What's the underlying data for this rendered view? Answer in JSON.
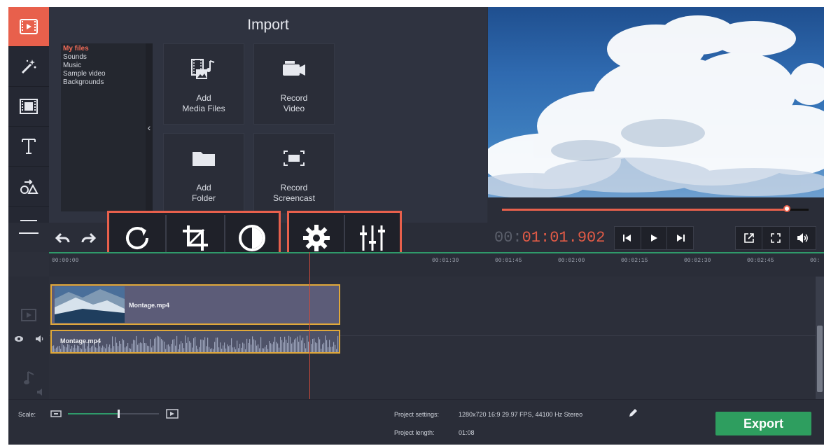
{
  "sidebar": {
    "items": [
      {
        "name": "import-tab",
        "icon": "film-import-icon",
        "active": true
      },
      {
        "name": "magic-tab",
        "icon": "magic-wand-icon",
        "active": false
      },
      {
        "name": "filters-tab",
        "icon": "film-strip-icon",
        "active": false
      },
      {
        "name": "titles-tab",
        "icon": "text-icon",
        "active": false
      },
      {
        "name": "transitions-tab",
        "icon": "shapes-icon",
        "active": false
      },
      {
        "name": "more-tab",
        "icon": "list-icon",
        "active": false
      }
    ]
  },
  "import": {
    "title": "Import",
    "files": [
      "My files",
      "Sounds",
      "Music",
      "Sample video",
      "Backgrounds"
    ],
    "collapse_glyph": "‹",
    "tiles": [
      {
        "label": "Add\nMedia Files",
        "icon": "media-files-icon"
      },
      {
        "label": "Record\nVideo",
        "icon": "video-camera-icon"
      },
      {
        "label": "Add\nFolder",
        "icon": "folder-icon"
      },
      {
        "label": "Record\nScreencast",
        "icon": "screencast-icon"
      }
    ]
  },
  "player": {
    "progress_fraction": 0.93,
    "timecode_dim": "00:",
    "timecode_main": "01:01.902"
  },
  "toolbar": {
    "tools": [
      "undo-icon",
      "redo-icon",
      "rotate-icon",
      "crop-icon",
      "color-adjust-icon",
      "settings-icon",
      "equalizer-icon"
    ]
  },
  "ruler": {
    "ticks": [
      "00:00:00",
      "00:01:30",
      "00:01:45",
      "00:02:00",
      "00:02:15",
      "00:02:30",
      "00:02:45",
      "00:"
    ]
  },
  "timeline": {
    "video_clip_name": "Montage.mp4",
    "audio_clip_name": "Montage.mp4"
  },
  "bottom": {
    "scale_label": "Scale:",
    "scale_fraction": 0.55,
    "settings_label": "Project settings:",
    "settings_value": "1280x720 16:9 29.97 FPS, 44100 Hz Stereo",
    "length_label": "Project length:",
    "length_value": "01:08",
    "export_label": "Export"
  },
  "colors": {
    "accent": "#e8604c",
    "export_green": "#2e9e5f",
    "timeline_green": "#2f9a6a"
  }
}
